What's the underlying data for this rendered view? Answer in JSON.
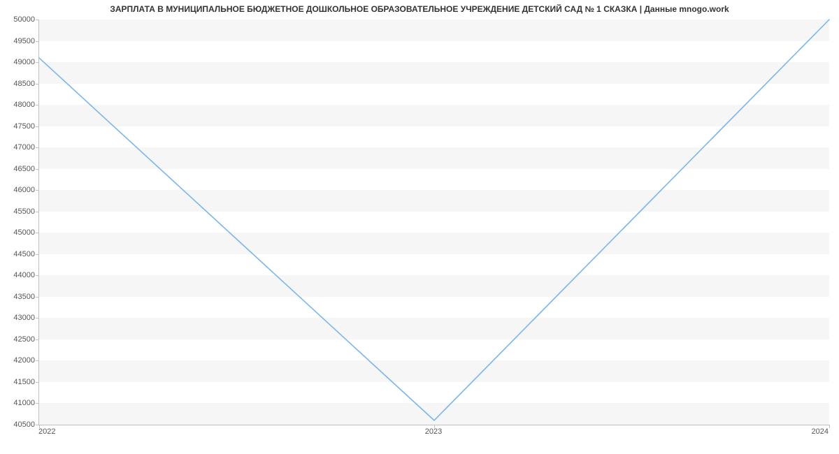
{
  "chart_data": {
    "type": "line",
    "title": "ЗАРПЛАТА В МУНИЦИПАЛЬНОЕ БЮДЖЕТНОЕ ДОШКОЛЬНОЕ ОБРАЗОВАТЕЛЬНОЕ УЧРЕЖДЕНИЕ ДЕТСКИЙ САД № 1 СКАЗКА | Данные mnogo.work",
    "xlabel": "",
    "ylabel": "",
    "x": [
      "2022",
      "2023",
      "2024"
    ],
    "values": [
      49100,
      40600,
      50000
    ],
    "ylim": [
      40500,
      50000
    ],
    "y_ticks": [
      40500,
      41000,
      41500,
      42000,
      42500,
      43000,
      43500,
      44000,
      44500,
      45000,
      45500,
      46000,
      46500,
      47000,
      47500,
      48000,
      48500,
      49000,
      49500,
      50000
    ],
    "y_tick_labels": [
      "40500",
      "41000",
      "41500",
      "42000",
      "42500",
      "43000",
      "43500",
      "44000",
      "44500",
      "45000",
      "45500",
      "46000",
      "46500",
      "47000",
      "47500",
      "48000",
      "48500",
      "49000",
      "49500",
      "50000"
    ],
    "x_tick_labels": [
      "2022",
      "2023",
      "2024"
    ],
    "line_color": "#7cb5ec"
  }
}
